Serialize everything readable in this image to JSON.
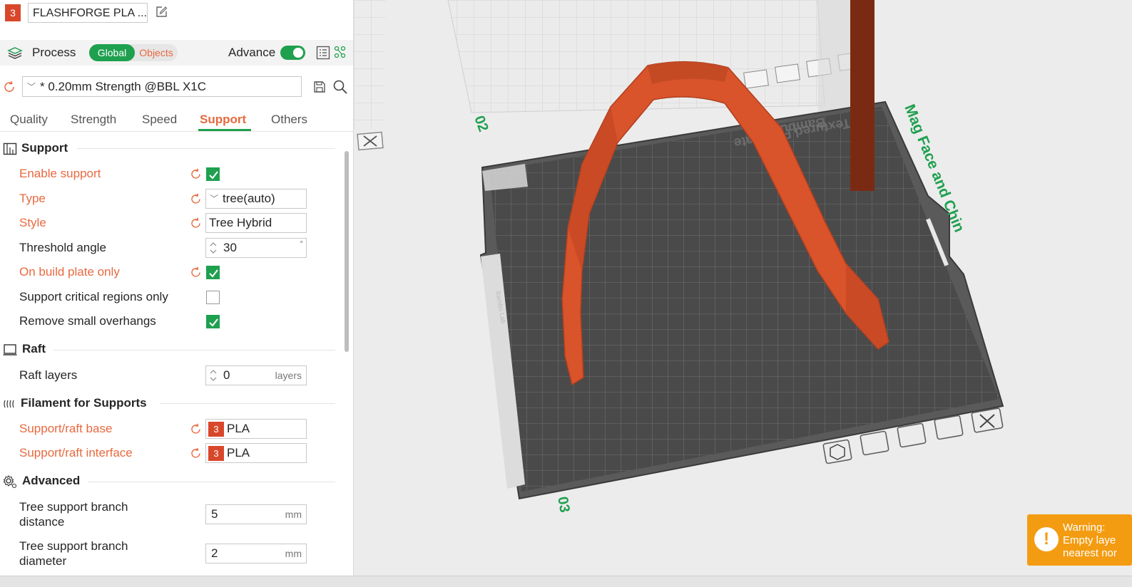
{
  "filament": {
    "index": "3",
    "name": "FLASHFORGE PLA ..."
  },
  "process": {
    "label": "Process",
    "global": "Global",
    "objects": "Objects",
    "advance_label": "Advance",
    "advance_on": true
  },
  "preset": {
    "name": "* 0.20mm Strength @BBL X1C"
  },
  "tabs": [
    {
      "label": "Quality",
      "active": false
    },
    {
      "label": "Strength",
      "active": false
    },
    {
      "label": "Speed",
      "active": false
    },
    {
      "label": "Support",
      "active": true
    },
    {
      "label": "Others",
      "active": false
    }
  ],
  "sections": {
    "support": {
      "title": "Support",
      "enable_support": {
        "label": "Enable support",
        "checked": true
      },
      "type": {
        "label": "Type",
        "value": "tree(auto)"
      },
      "style": {
        "label": "Style",
        "value": "Tree Hybrid"
      },
      "threshold": {
        "label": "Threshold angle",
        "value": "30",
        "unit": "°"
      },
      "build_plate_only": {
        "label": "On build plate only",
        "checked": true
      },
      "critical_regions": {
        "label": "Support critical regions only",
        "checked": false
      },
      "small_overhangs": {
        "label": "Remove small overhangs",
        "checked": true
      }
    },
    "raft": {
      "title": "Raft",
      "raft_layers": {
        "label": "Raft layers",
        "value": "0",
        "unit": "layers"
      }
    },
    "filament_supports": {
      "title": "Filament for Supports",
      "base": {
        "label": "Support/raft base",
        "badge": "3",
        "value": "PLA"
      },
      "interface": {
        "label": "Support/raft interface",
        "badge": "3",
        "value": "PLA"
      }
    },
    "advanced": {
      "title": "Advanced",
      "branch_distance": {
        "label_line1": "Tree support branch",
        "label_line2": "distance",
        "value": "5",
        "unit": "mm"
      },
      "branch_diameter": {
        "label_line1": "Tree support branch",
        "label_line2": "diameter",
        "value": "2",
        "unit": "mm"
      }
    }
  },
  "viewport": {
    "plate2_label": "02",
    "plate3_label": "03",
    "plate_name": "Mag Face and Chin",
    "bed_text": "Textured PEI Plate",
    "bed_text2": "Bambu",
    "bed_side_text": "Bambu Lab"
  },
  "warning": {
    "line1": "Warning:",
    "line2": "Empty laye",
    "line3": "nearest nor"
  },
  "colors": {
    "accent_green": "#1fa04f",
    "modified_orange": "#e8693f",
    "model_orange": "#d9532b",
    "warning": "#f39c12"
  }
}
